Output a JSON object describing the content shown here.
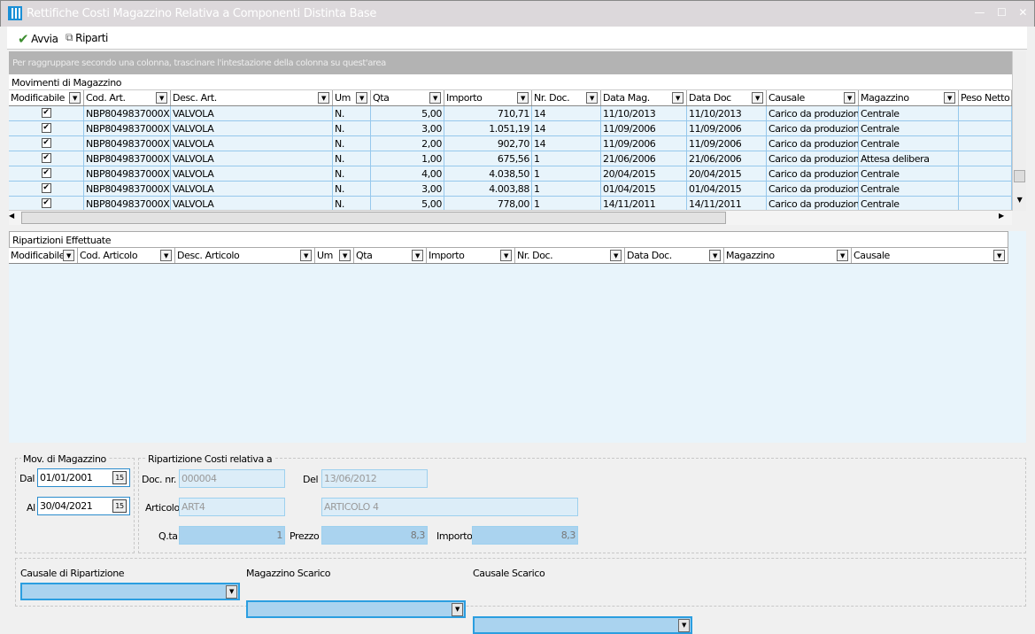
{
  "window": {
    "title": "Rettifiche Costi Magazzino Relativa a Componenti Distinta Base",
    "icon": "maze-app-icon"
  },
  "toolbar": {
    "avvia": "Avvia",
    "riparti": "Riparti"
  },
  "grid1": {
    "group_hint": "Per raggruppare secondo una colonna, trascinare l'intestazione della colonna su quest'area",
    "title": "Movimenti di Magazzino",
    "columns": [
      "Modificabile",
      "Cod. Art.",
      "Desc. Art.",
      "Um",
      "Qta",
      "Importo",
      "Nr. Doc.",
      "Data Mag.",
      "Data Doc",
      "Causale",
      "Magazzino",
      "Peso Netto"
    ],
    "rows": [
      [
        "true",
        "NBP8049837000X",
        "VALVOLA",
        "N.",
        "5,00",
        "710,71",
        "14",
        "11/10/2013",
        "11/10/2013",
        "Carico da produzione",
        "Centrale",
        ""
      ],
      [
        "true",
        "NBP8049837000X",
        "VALVOLA",
        "N.",
        "3,00",
        "1.051,19",
        "14",
        "11/09/2006",
        "11/09/2006",
        "Carico da produzione",
        "Centrale",
        ""
      ],
      [
        "true",
        "NBP8049837000X",
        "VALVOLA",
        "N.",
        "2,00",
        "902,70",
        "14",
        "11/09/2006",
        "11/09/2006",
        "Carico da produzione",
        "Centrale",
        ""
      ],
      [
        "true",
        "NBP8049837000X",
        "VALVOLA",
        "N.",
        "1,00",
        "675,56",
        "1",
        "21/06/2006",
        "21/06/2006",
        "Carico da produzione",
        "Attesa delibera",
        ""
      ],
      [
        "true",
        "NBP8049837000X",
        "VALVOLA",
        "N.",
        "4,00",
        "4.038,50",
        "1",
        "20/04/2015",
        "20/04/2015",
        "Carico da produzione",
        "Centrale",
        ""
      ],
      [
        "true",
        "NBP8049837000X",
        "VALVOLA",
        "N.",
        "3,00",
        "4.003,88",
        "1",
        "01/04/2015",
        "01/04/2015",
        "Carico da produzione",
        "Centrale",
        ""
      ],
      [
        "true",
        "NBP8049837000X",
        "VALVOLA",
        "N.",
        "5,00",
        "778,00",
        "1",
        "14/11/2011",
        "14/11/2011",
        "Carico da produzione",
        "Centrale",
        ""
      ]
    ]
  },
  "grid2": {
    "title": "Ripartizioni Effettuate",
    "columns": [
      "Modificabile",
      "Cod. Articolo",
      "Desc. Articolo",
      "Um",
      "Qta",
      "Importo",
      "Nr. Doc.",
      "Data Doc.",
      "Magazzino",
      "Causale"
    ]
  },
  "mov": {
    "title": "Mov. di Magazzino",
    "dal_label": "Dal",
    "dal": "01/01/2001",
    "al_label": "Al",
    "al": "30/04/2021",
    "cal": "15"
  },
  "rip": {
    "title": "Ripartizione Costi relativa a",
    "doc_label": "Doc. nr.",
    "doc": "000004",
    "del_label": "Del",
    "del": "13/06/2012",
    "art_label": "Articolo",
    "art": "ART4",
    "art_desc": "ARTICOLO 4",
    "qta_label": "Q.ta",
    "qta": "1",
    "prezzo_label": "Prezzo",
    "prezzo": "8,3",
    "importo_label": "Importo",
    "importo": "8,3"
  },
  "bottom": {
    "causale_rip": "Causale di Ripartizione",
    "mag_scarico": "Magazzino Scarico",
    "causale_scarico": "Causale Scarico"
  }
}
